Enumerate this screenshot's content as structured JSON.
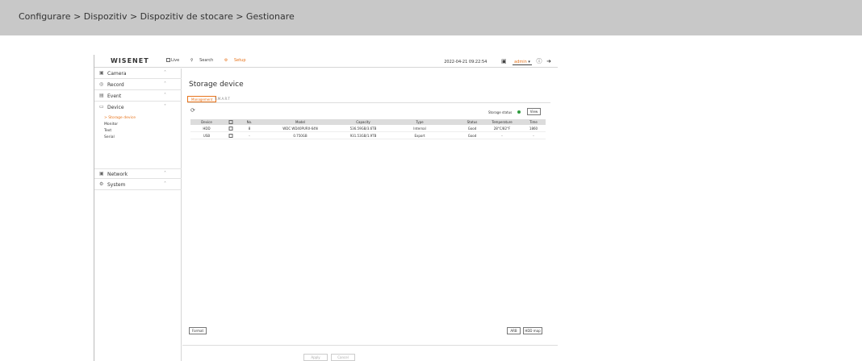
{
  "breadcrumb": "Configurare > Dispozitiv > Dispozitiv de stocare > Gestionare",
  "app": {
    "logo": "WISENET",
    "nav": [
      {
        "label": "Live",
        "icon": "live-icon"
      },
      {
        "label": "Search",
        "icon": "search-icon"
      },
      {
        "label": "Setup",
        "icon": "setup-icon",
        "active": true
      }
    ],
    "datetime": "2022-04-21 09:22:54",
    "user": "admin",
    "accent": "#e8731a"
  },
  "sidebar": {
    "items": [
      {
        "label": "Camera",
        "icon": "camera-icon",
        "chevron": "^"
      },
      {
        "label": "Record",
        "icon": "record-icon",
        "chevron": "^"
      },
      {
        "label": "Event",
        "icon": "event-icon",
        "chevron": "^"
      },
      {
        "label": "Device",
        "icon": "device-icon",
        "chevron": "v"
      },
      {
        "label": "Network",
        "icon": "network-icon",
        "chevron": "^"
      },
      {
        "label": "System",
        "icon": "system-icon",
        "chevron": "^"
      }
    ],
    "device_sub": [
      {
        "label": "> Storage device",
        "active": true
      },
      {
        "label": "Monitor"
      },
      {
        "label": "Text"
      },
      {
        "label": "Serial"
      }
    ]
  },
  "page": {
    "title": "Storage device",
    "tabs": [
      "Management",
      "S.M.A.R.T"
    ],
    "storage_status_label": "Storage status",
    "status_color": "#2e9b3e",
    "view_label": "View"
  },
  "table": {
    "columns": [
      "Device",
      "",
      "No.",
      "Model",
      "Capacity",
      "Type",
      "Status",
      "Temperature",
      "Time"
    ],
    "rows": [
      {
        "device": "HDD",
        "no": "8",
        "model": "WDC WD40PURX-64N",
        "capacity": "536.59GB/3.6TB",
        "type": "Internal",
        "status": "Good",
        "temperature": "28°C/82°F",
        "time": "1860"
      },
      {
        "device": "USB",
        "no": "-",
        "model": "0.750GB",
        "capacity": "931.53GB/1.9TB",
        "type": "Export",
        "status": "Good",
        "temperature": "-",
        "time": "-"
      }
    ]
  },
  "buttons": {
    "format": "Format",
    "arb": "ARB",
    "hdd_map": "HDD map",
    "apply": "Apply",
    "reset": "Cancel"
  }
}
